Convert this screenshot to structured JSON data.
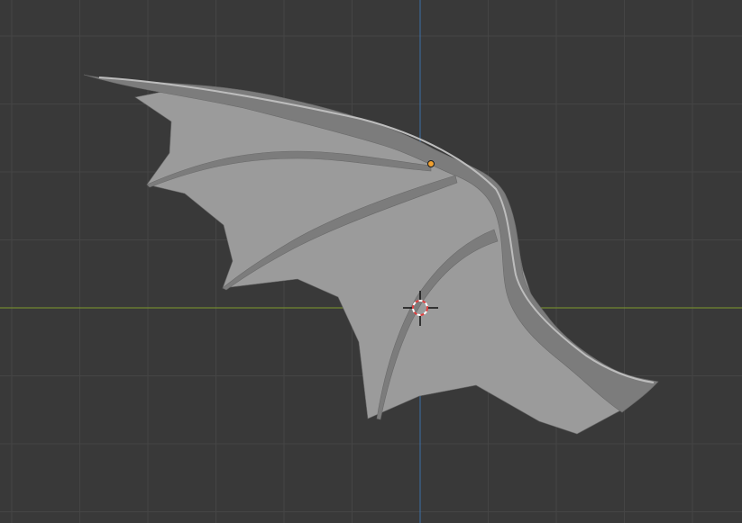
{
  "viewport": {
    "background_color": "#393939",
    "grid_color": "#454545",
    "x_axis_color": "#7f9a2d",
    "y_axis_color": "#3c6fa8"
  },
  "mesh": {
    "object": "bat-wing",
    "fill_color": "#9b9b9b",
    "shade_color": "#7c7c7c",
    "highlight_color": "#bdbdbd",
    "outline_color": "#6a6a6a"
  },
  "origin_point": {
    "icon": "object-origin-icon",
    "color": "#f0a030"
  },
  "cursor_3d": {
    "icon": "3d-cursor-icon",
    "ring_color_a": "#e04040",
    "ring_color_b": "#ffffff",
    "crosshair_color": "#101010"
  }
}
